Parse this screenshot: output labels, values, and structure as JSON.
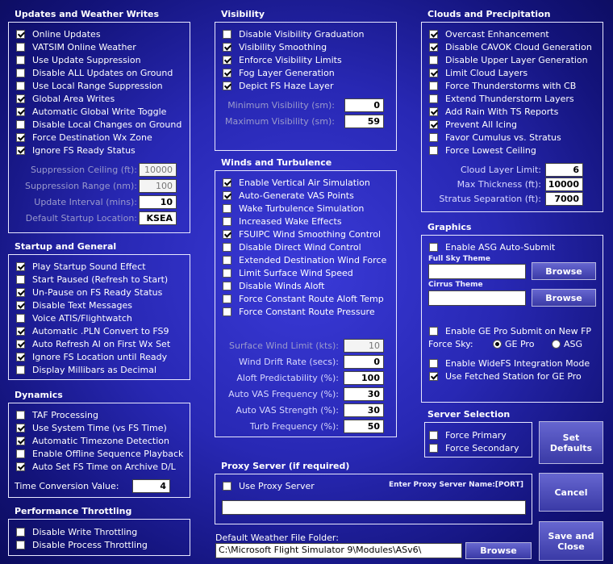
{
  "updates": {
    "title": "Updates and Weather Writes",
    "items": [
      {
        "label": "Online Updates",
        "checked": true
      },
      {
        "label": "VATSIM Online Weather",
        "checked": false
      },
      {
        "label": "Use Update Suppression",
        "checked": false
      },
      {
        "label": "Disable ALL Updates on Ground",
        "checked": false
      },
      {
        "label": "Use Local Range Suppression",
        "checked": false
      },
      {
        "label": "Global Area Writes",
        "checked": true
      },
      {
        "label": "Automatic Global Write Toggle",
        "checked": true
      },
      {
        "label": "Disable Local Changes on Ground",
        "checked": false
      },
      {
        "label": "Force Destination Wx Zone",
        "checked": true
      },
      {
        "label": "Ignore FS Ready Status",
        "checked": true
      }
    ],
    "fields": [
      {
        "label": "Suppression Ceiling (ft):",
        "value": "10000"
      },
      {
        "label": "Suppression Range (nm):",
        "value": "100"
      },
      {
        "label": "Update Interval (mins):",
        "value": "10"
      },
      {
        "label": "Default Startup Location:",
        "value": "KSEA"
      }
    ]
  },
  "startup": {
    "title": "Startup and General",
    "items": [
      {
        "label": "Play Startup Sound Effect",
        "checked": true
      },
      {
        "label": "Start Paused (Refresh to Start)",
        "checked": false
      },
      {
        "label": "Un-Pause on FS Ready Status",
        "checked": true
      },
      {
        "label": "Disable Text Messages",
        "checked": true
      },
      {
        "label": "Voice ATIS/Flightwatch",
        "checked": false
      },
      {
        "label": "Automatic .PLN Convert to FS9",
        "checked": true
      },
      {
        "label": "Auto Refresh AI on First Wx Set",
        "checked": true
      },
      {
        "label": "Ignore FS Location until Ready",
        "checked": true
      },
      {
        "label": "Display Millibars as Decimal",
        "checked": false
      }
    ]
  },
  "dynamics": {
    "title": "Dynamics",
    "items": [
      {
        "label": "TAF Processing",
        "checked": false
      },
      {
        "label": "Use System Time (vs FS Time)",
        "checked": true
      },
      {
        "label": "Automatic Timezone Detection",
        "checked": true
      },
      {
        "label": "Enable Offline Sequence Playback",
        "checked": false
      },
      {
        "label": "Auto Set FS Time on Archive D/L",
        "checked": true
      }
    ],
    "field": {
      "label": "Time Conversion Value:",
      "value": "4"
    }
  },
  "throttling": {
    "title": "Performance Throttling",
    "items": [
      {
        "label": "Disable Write Throttling",
        "checked": false
      },
      {
        "label": "Disable Process Throttling",
        "checked": false
      }
    ]
  },
  "visibility": {
    "title": "Visibility",
    "items": [
      {
        "label": "Disable Visibility Graduation",
        "checked": false
      },
      {
        "label": "Visibility Smoothing",
        "checked": true
      },
      {
        "label": "Enforce Visibility Limits",
        "checked": true
      },
      {
        "label": "Fog Layer Generation",
        "checked": true
      },
      {
        "label": "Depict FS Haze Layer",
        "checked": true
      }
    ],
    "fields": [
      {
        "label": "Minimum Visibility (sm):",
        "value": "0"
      },
      {
        "label": "Maximum Visibility (sm):",
        "value": "59"
      }
    ]
  },
  "winds": {
    "title": "Winds and Turbulence",
    "items": [
      {
        "label": "Enable Vertical Air Simulation",
        "checked": true
      },
      {
        "label": "Auto-Generate VAS Points",
        "checked": true
      },
      {
        "label": "Wake Turbulence Simulation",
        "checked": false
      },
      {
        "label": "Increased Wake Effects",
        "checked": false
      },
      {
        "label": "FSUIPC Wind Smoothing Control",
        "checked": true
      },
      {
        "label": "Disable Direct Wind Control",
        "checked": false
      },
      {
        "label": "Extended Destination Wind Force",
        "checked": false
      },
      {
        "label": "Limit Surface Wind Speed",
        "checked": false
      },
      {
        "label": "Disable Winds Aloft",
        "checked": false
      },
      {
        "label": "Force Constant Route Aloft Temp",
        "checked": false
      },
      {
        "label": "Force Constant Route Pressure",
        "checked": false
      }
    ],
    "fields": [
      {
        "label": "Surface Wind Limit (kts):",
        "value": "10"
      },
      {
        "label": "Wind Drift Rate (secs):",
        "value": "0"
      },
      {
        "label": "Aloft Predictability (%):",
        "value": "100"
      },
      {
        "label": "Auto VAS Frequency (%):",
        "value": "30"
      },
      {
        "label": "Auto VAS Strength (%):",
        "value": "30"
      },
      {
        "label": "Turb Frequency (%):",
        "value": "50"
      }
    ]
  },
  "proxy": {
    "title": "Proxy Server (if required)",
    "use_label": "Use Proxy Server",
    "use_checked": false,
    "hint": "Enter Proxy Server Name:[PORT]",
    "value": ""
  },
  "folder": {
    "label": "Default Weather File Folder:",
    "value": "C:\\Microsoft Flight Simulator 9\\Modules\\ASv6\\",
    "browse": "Browse"
  },
  "clouds": {
    "title": "Clouds and Precipitation",
    "items": [
      {
        "label": "Overcast Enhancement",
        "checked": true
      },
      {
        "label": "Disable CAVOK Cloud Generation",
        "checked": true
      },
      {
        "label": "Disable Upper Layer Generation",
        "checked": false
      },
      {
        "label": "Limit Cloud Layers",
        "checked": true
      },
      {
        "label": "Force Thunderstorms with CB",
        "checked": false
      },
      {
        "label": "Extend Thunderstorm Layers",
        "checked": false
      },
      {
        "label": "Add Rain With TS Reports",
        "checked": true
      },
      {
        "label": "Prevent All Icing",
        "checked": true
      },
      {
        "label": "Favor Cumulus vs. Stratus",
        "checked": false
      },
      {
        "label": "Force Lowest Ceiling",
        "checked": false
      }
    ],
    "fields": [
      {
        "label": "Cloud Layer Limit:",
        "value": "6"
      },
      {
        "label": "Max Thickness (ft):",
        "value": "10000"
      },
      {
        "label": "Stratus Separation (ft):",
        "value": "7000"
      }
    ]
  },
  "graphics": {
    "title": "Graphics",
    "asg_label": "Enable ASG Auto-Submit",
    "asg_checked": false,
    "full_sky_label": "Full Sky Theme",
    "full_sky_value": "",
    "cirrus_label": "Cirrus Theme",
    "cirrus_value": "",
    "browse": "Browse",
    "gepro_submit_label": "Enable GE Pro Submit on New FP",
    "gepro_submit_checked": false,
    "force_sky_label": "Force Sky:",
    "radio_gepro": "GE Pro",
    "radio_asg": "ASG",
    "widefs_label": "Enable WideFS Integration Mode",
    "widefs_checked": false,
    "fetched_label": "Use Fetched Station for GE Pro",
    "fetched_checked": true
  },
  "server": {
    "title": "Server Selection",
    "items": [
      {
        "label": "Force Primary",
        "checked": false
      },
      {
        "label": "Force Secondary",
        "checked": false
      }
    ]
  },
  "buttons": {
    "set_defaults": "Set\nDefaults",
    "cancel": "Cancel",
    "save_close": "Save and\nClose"
  }
}
